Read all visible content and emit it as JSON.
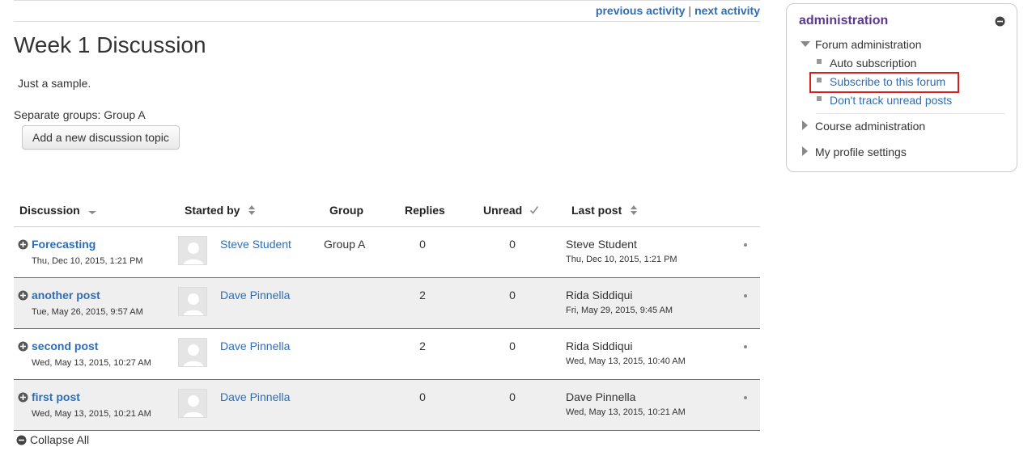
{
  "nav": {
    "previous_activity": "previous activity",
    "separator": "|",
    "next_activity": "next activity"
  },
  "page": {
    "title": "Week 1 Discussion",
    "intro": "Just a sample.",
    "groups_label": "Separate groups: Group A",
    "add_topic_button": "Add a new discussion topic"
  },
  "table": {
    "headers": {
      "discussion": "Discussion",
      "started_by": "Started by",
      "group": "Group",
      "replies": "Replies",
      "unread": "Unread",
      "last_post": "Last post"
    },
    "rows": [
      {
        "topic": "Forecasting",
        "topic_date": "Thu, Dec 10, 2015, 1:21 PM",
        "author": "Steve Student",
        "group": "Group A",
        "replies": "0",
        "unread": "0",
        "last_post_author": "Steve Student",
        "last_post_date": "Thu, Dec 10, 2015, 1:21 PM"
      },
      {
        "topic": "another post",
        "topic_date": "Tue, May 26, 2015, 9:57 AM",
        "author": "Dave Pinnella",
        "group": "",
        "replies": "2",
        "unread": "0",
        "last_post_author": "Rida Siddiqui",
        "last_post_date": "Fri, May 29, 2015, 9:45 AM"
      },
      {
        "topic": "second post",
        "topic_date": "Wed, May 13, 2015, 10:27 AM",
        "author": "Dave Pinnella",
        "group": "",
        "replies": "2",
        "unread": "0",
        "last_post_author": "Rida Siddiqui",
        "last_post_date": "Wed, May 13, 2015, 10:40 AM"
      },
      {
        "topic": "first post",
        "topic_date": "Wed, May 13, 2015, 10:21 AM",
        "author": "Dave Pinnella",
        "group": "",
        "replies": "0",
        "unread": "0",
        "last_post_author": "Dave Pinnella",
        "last_post_date": "Wed, May 13, 2015, 10:21 AM"
      }
    ],
    "collapse_all": "Collapse All"
  },
  "admin": {
    "title": "administration",
    "forum_admin": "Forum administration",
    "auto_subscription": "Auto subscription",
    "subscribe": "Subscribe to this forum",
    "dont_track": "Don't track unread posts",
    "course_admin": "Course administration",
    "profile_settings": "My profile settings"
  },
  "icons": {
    "expand": "plus-circle-icon",
    "collapse": "minus-circle-icon",
    "sort": "sort-updown-icon",
    "unread_check": "check-icon",
    "avatar": "default-user-avatar"
  },
  "colors": {
    "link": "#2f6db5",
    "admin_title": "#5a3a8e",
    "highlight": "#d62020",
    "row_alt": "#efefef"
  }
}
